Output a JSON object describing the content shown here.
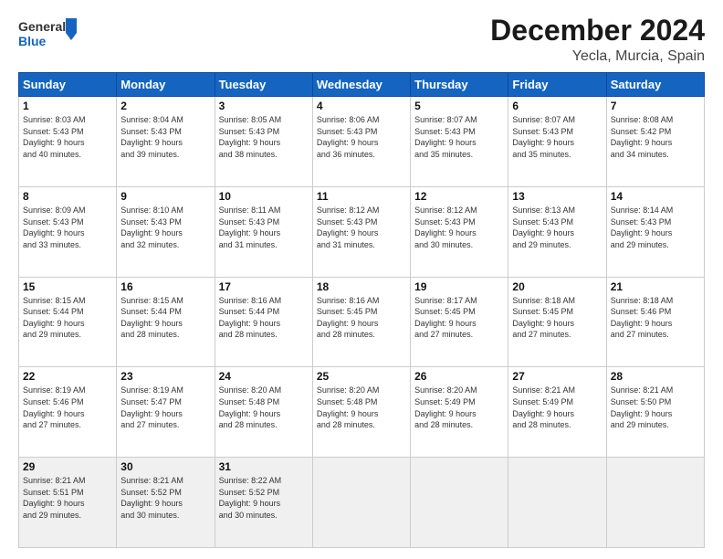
{
  "header": {
    "logo_general": "General",
    "logo_blue": "Blue",
    "month_title": "December 2024",
    "location": "Yecla, Murcia, Spain"
  },
  "weekdays": [
    "Sunday",
    "Monday",
    "Tuesday",
    "Wednesday",
    "Thursday",
    "Friday",
    "Saturday"
  ],
  "weeks": [
    [
      {
        "day": "1",
        "info": "Sunrise: 8:03 AM\nSunset: 5:43 PM\nDaylight: 9 hours\nand 40 minutes."
      },
      {
        "day": "2",
        "info": "Sunrise: 8:04 AM\nSunset: 5:43 PM\nDaylight: 9 hours\nand 39 minutes."
      },
      {
        "day": "3",
        "info": "Sunrise: 8:05 AM\nSunset: 5:43 PM\nDaylight: 9 hours\nand 38 minutes."
      },
      {
        "day": "4",
        "info": "Sunrise: 8:06 AM\nSunset: 5:43 PM\nDaylight: 9 hours\nand 36 minutes."
      },
      {
        "day": "5",
        "info": "Sunrise: 8:07 AM\nSunset: 5:43 PM\nDaylight: 9 hours\nand 35 minutes."
      },
      {
        "day": "6",
        "info": "Sunrise: 8:07 AM\nSunset: 5:43 PM\nDaylight: 9 hours\nand 35 minutes."
      },
      {
        "day": "7",
        "info": "Sunrise: 8:08 AM\nSunset: 5:42 PM\nDaylight: 9 hours\nand 34 minutes."
      }
    ],
    [
      {
        "day": "8",
        "info": "Sunrise: 8:09 AM\nSunset: 5:43 PM\nDaylight: 9 hours\nand 33 minutes."
      },
      {
        "day": "9",
        "info": "Sunrise: 8:10 AM\nSunset: 5:43 PM\nDaylight: 9 hours\nand 32 minutes."
      },
      {
        "day": "10",
        "info": "Sunrise: 8:11 AM\nSunset: 5:43 PM\nDaylight: 9 hours\nand 31 minutes."
      },
      {
        "day": "11",
        "info": "Sunrise: 8:12 AM\nSunset: 5:43 PM\nDaylight: 9 hours\nand 31 minutes."
      },
      {
        "day": "12",
        "info": "Sunrise: 8:12 AM\nSunset: 5:43 PM\nDaylight: 9 hours\nand 30 minutes."
      },
      {
        "day": "13",
        "info": "Sunrise: 8:13 AM\nSunset: 5:43 PM\nDaylight: 9 hours\nand 29 minutes."
      },
      {
        "day": "14",
        "info": "Sunrise: 8:14 AM\nSunset: 5:43 PM\nDaylight: 9 hours\nand 29 minutes."
      }
    ],
    [
      {
        "day": "15",
        "info": "Sunrise: 8:15 AM\nSunset: 5:44 PM\nDaylight: 9 hours\nand 29 minutes."
      },
      {
        "day": "16",
        "info": "Sunrise: 8:15 AM\nSunset: 5:44 PM\nDaylight: 9 hours\nand 28 minutes."
      },
      {
        "day": "17",
        "info": "Sunrise: 8:16 AM\nSunset: 5:44 PM\nDaylight: 9 hours\nand 28 minutes."
      },
      {
        "day": "18",
        "info": "Sunrise: 8:16 AM\nSunset: 5:45 PM\nDaylight: 9 hours\nand 28 minutes."
      },
      {
        "day": "19",
        "info": "Sunrise: 8:17 AM\nSunset: 5:45 PM\nDaylight: 9 hours\nand 27 minutes."
      },
      {
        "day": "20",
        "info": "Sunrise: 8:18 AM\nSunset: 5:45 PM\nDaylight: 9 hours\nand 27 minutes."
      },
      {
        "day": "21",
        "info": "Sunrise: 8:18 AM\nSunset: 5:46 PM\nDaylight: 9 hours\nand 27 minutes."
      }
    ],
    [
      {
        "day": "22",
        "info": "Sunrise: 8:19 AM\nSunset: 5:46 PM\nDaylight: 9 hours\nand 27 minutes."
      },
      {
        "day": "23",
        "info": "Sunrise: 8:19 AM\nSunset: 5:47 PM\nDaylight: 9 hours\nand 27 minutes."
      },
      {
        "day": "24",
        "info": "Sunrise: 8:20 AM\nSunset: 5:48 PM\nDaylight: 9 hours\nand 28 minutes."
      },
      {
        "day": "25",
        "info": "Sunrise: 8:20 AM\nSunset: 5:48 PM\nDaylight: 9 hours\nand 28 minutes."
      },
      {
        "day": "26",
        "info": "Sunrise: 8:20 AM\nSunset: 5:49 PM\nDaylight: 9 hours\nand 28 minutes."
      },
      {
        "day": "27",
        "info": "Sunrise: 8:21 AM\nSunset: 5:49 PM\nDaylight: 9 hours\nand 28 minutes."
      },
      {
        "day": "28",
        "info": "Sunrise: 8:21 AM\nSunset: 5:50 PM\nDaylight: 9 hours\nand 29 minutes."
      }
    ],
    [
      {
        "day": "29",
        "info": "Sunrise: 8:21 AM\nSunset: 5:51 PM\nDaylight: 9 hours\nand 29 minutes."
      },
      {
        "day": "30",
        "info": "Sunrise: 8:21 AM\nSunset: 5:52 PM\nDaylight: 9 hours\nand 30 minutes."
      },
      {
        "day": "31",
        "info": "Sunrise: 8:22 AM\nSunset: 5:52 PM\nDaylight: 9 hours\nand 30 minutes."
      },
      null,
      null,
      null,
      null
    ]
  ]
}
